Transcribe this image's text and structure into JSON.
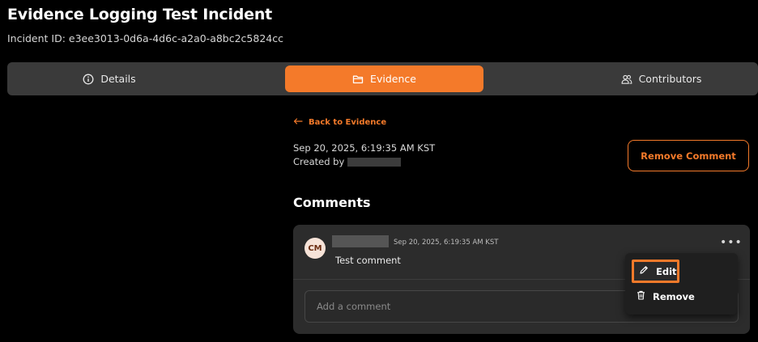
{
  "header": {
    "title": "Evidence Logging Test Incident",
    "incident_id": "Incident ID: e3ee3013-0d6a-4d6c-a2a0-a8bc2c5824cc"
  },
  "tabs": [
    {
      "label": "Details",
      "icon": "info-icon",
      "active": false
    },
    {
      "label": "Evidence",
      "icon": "folder-icon",
      "active": true
    },
    {
      "label": "Contributors",
      "icon": "users-icon",
      "active": false
    }
  ],
  "evidence": {
    "back_label": "Back to Evidence",
    "timestamp": "Sep 20, 2025, 6:19:35 AM KST",
    "created_by_label": "Created by",
    "remove_comment_label": "Remove Comment"
  },
  "comments": {
    "heading": "Comments",
    "items": [
      {
        "avatar_initials": "CM",
        "timestamp": "Sep 20, 2025, 6:19:35 AM KST",
        "text": "Test comment"
      }
    ],
    "add_placeholder": "Add a comment"
  },
  "menu": {
    "edit_label": "Edit",
    "remove_label": "Remove"
  },
  "colors": {
    "accent": "#f47a2a",
    "background": "#000000",
    "tabbar": "#3a3a3a",
    "card": "#2c2c2c"
  }
}
